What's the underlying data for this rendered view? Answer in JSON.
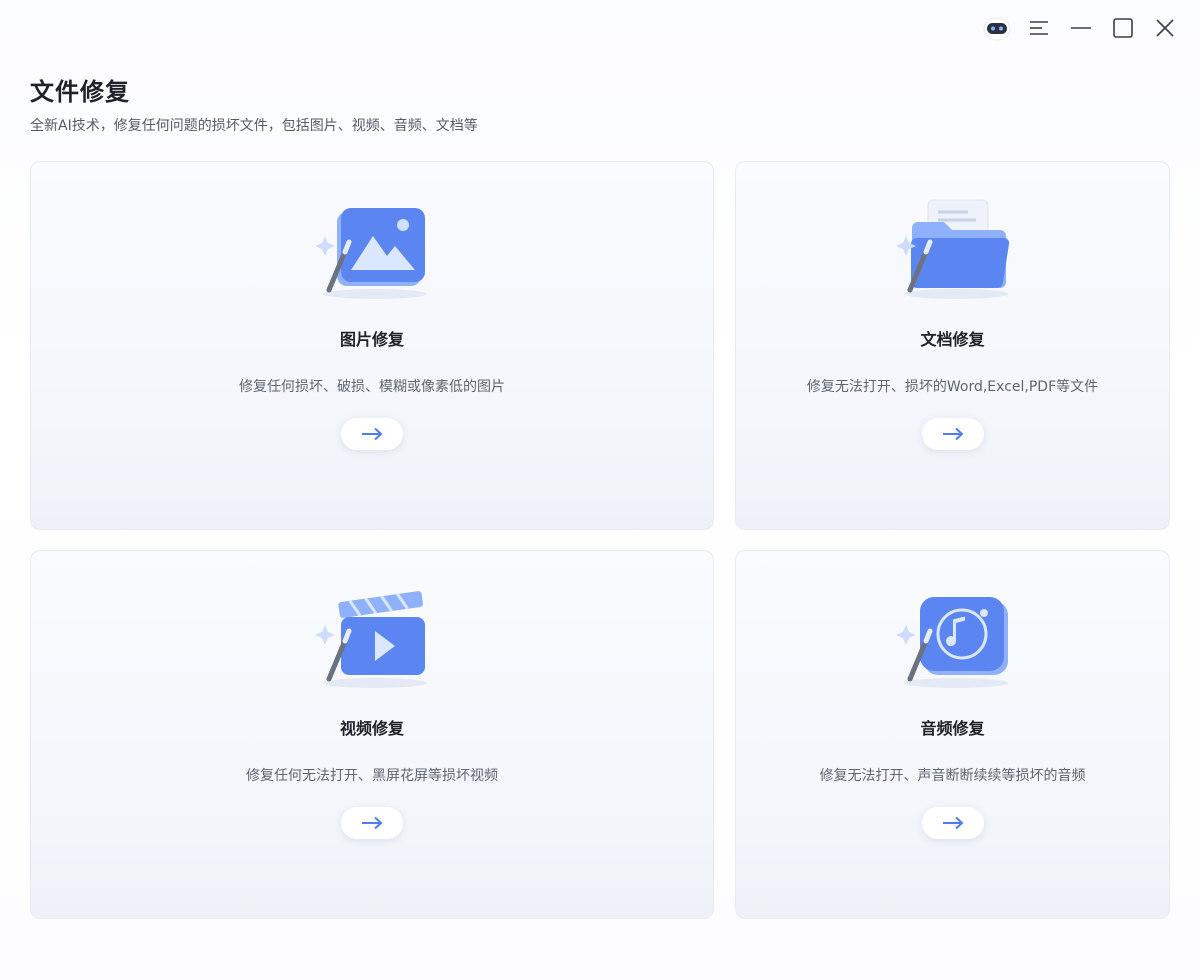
{
  "app": {
    "title": "文件修复",
    "subtitle": "全新AI技术，修复任何问题的损坏文件，包括图片、视频、音频、文档等"
  },
  "window_controls": [
    {
      "name": "robot-assistant-icon"
    },
    {
      "name": "menu-icon"
    },
    {
      "name": "minimize-icon"
    },
    {
      "name": "maximize-icon"
    },
    {
      "name": "close-icon"
    }
  ],
  "cards": [
    {
      "title": "图片修复",
      "desc": "修复任何损坏、破损、模糊或像素低的图片",
      "icon": "image-repair-icon",
      "button_icon": "arrow-right-icon"
    },
    {
      "title": "文档修复",
      "desc": "修复无法打开、损坏的Word,Excel,PDF等文件",
      "icon": "document-repair-icon",
      "button_icon": "arrow-right-icon"
    },
    {
      "title": "视频修复",
      "desc": "修复任何无法打开、黑屏花屏等损坏视频",
      "icon": "video-repair-icon",
      "button_icon": "arrow-right-icon"
    },
    {
      "title": "音频修复",
      "desc": "修复无法打开、声音断断续续等损坏的音频",
      "icon": "audio-repair-icon",
      "button_icon": "arrow-right-icon"
    }
  ],
  "colors": {
    "accent": "#4f7df0",
    "accent_light": "#8fb0fa",
    "title": "#1f2329",
    "text": "#5f6570",
    "card_border": "#e6ebf3"
  }
}
